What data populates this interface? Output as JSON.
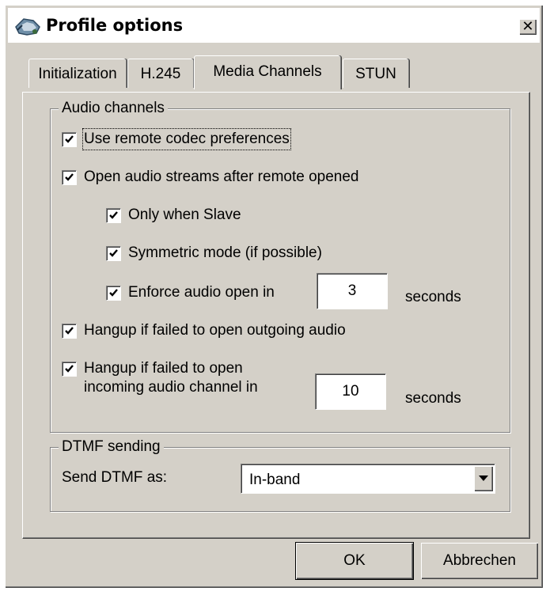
{
  "window": {
    "title": "Profile options",
    "close_glyph": "✕",
    "icon": "phone-app-icon"
  },
  "tabs": [
    {
      "label": "Initialization",
      "active": false
    },
    {
      "label": "H.245",
      "active": false
    },
    {
      "label": "Media Channels",
      "active": true
    },
    {
      "label": "STUN",
      "active": false
    }
  ],
  "audio_channels": {
    "title": "Audio channels",
    "use_remote_codec": {
      "label": "Use remote codec preferences",
      "checked": true
    },
    "open_after_remote": {
      "label": "Open audio streams after remote opened",
      "checked": true
    },
    "only_when_slave": {
      "label": "Only when Slave",
      "checked": true
    },
    "symmetric_mode": {
      "label": "Symmetric mode (if possible)",
      "checked": true
    },
    "enforce_open": {
      "label": "Enforce audio open in",
      "checked": true,
      "value": "3",
      "unit": "seconds"
    },
    "hangup_outgoing": {
      "label": "Hangup if failed to open outgoing audio",
      "checked": true
    },
    "hangup_incoming": {
      "label_line1": "Hangup if failed to open",
      "label_line2": "incoming audio channel in",
      "checked": true,
      "value": "10",
      "unit": "seconds"
    }
  },
  "dtmf": {
    "title": "DTMF sending",
    "label": "Send DTMF as:",
    "selected": "In-band"
  },
  "buttons": {
    "ok": "OK",
    "cancel": "Abbrechen"
  },
  "colors": {
    "face": "#d4d0c8",
    "shadow": "#808080",
    "highlight": "#ffffff",
    "dark_shadow": "#404040"
  }
}
